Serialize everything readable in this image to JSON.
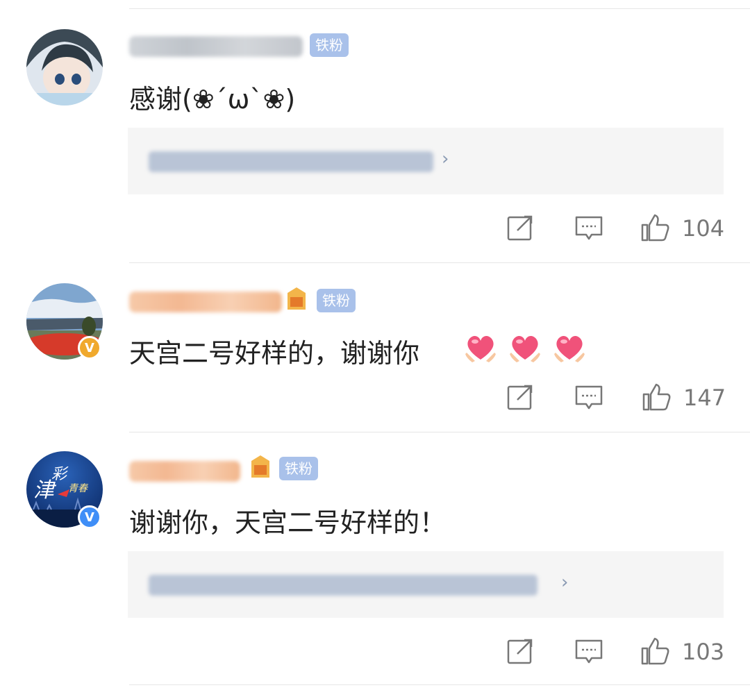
{
  "fan_badge_label": "铁粉",
  "comments": [
    {
      "text": "感谢(❀´ω`❀)",
      "likes": "104",
      "verified": false,
      "has_replies": true
    },
    {
      "text": "天宫二号好样的，谢谢你",
      "likes": "147",
      "verified": true,
      "verified_color": "#f0a92d",
      "emoji": "heart-hands-icon",
      "emoji_count": 3,
      "has_replies": false
    },
    {
      "text": "谢谢你，天宫二号好样的！",
      "likes": "103",
      "verified": true,
      "verified_color": "#3f8ef7",
      "avatar_text_1": "津",
      "avatar_text_2": "彩",
      "avatar_text_3": "青春",
      "has_replies": true
    }
  ],
  "icons": {
    "share": "share-icon",
    "comment": "comment-icon",
    "like": "thumbs-up-icon"
  },
  "colors": {
    "fan_badge": "#a9c1ea",
    "divider": "#e6e6e6",
    "reply_bg": "#f5f5f5",
    "text": "#222222",
    "count": "#777777"
  }
}
